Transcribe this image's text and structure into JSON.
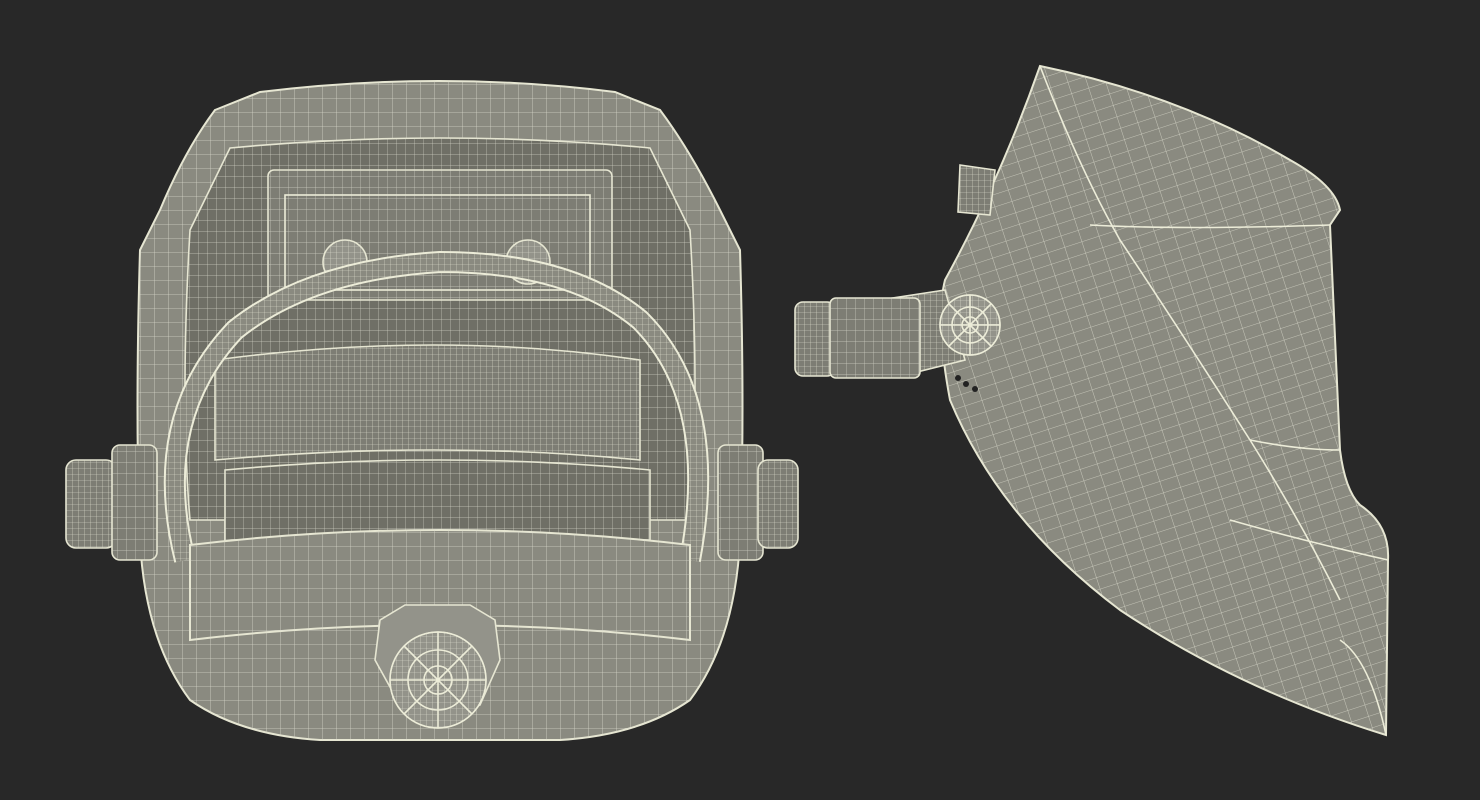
{
  "scene": {
    "background_color": "#282828",
    "surface_color": "#8a8a80",
    "wire_color": "#e6e6d2",
    "views": [
      {
        "id": "back-view",
        "subject": "welding-helmet-wireframe"
      },
      {
        "id": "side-view",
        "subject": "welding-helmet-wireframe"
      }
    ]
  }
}
